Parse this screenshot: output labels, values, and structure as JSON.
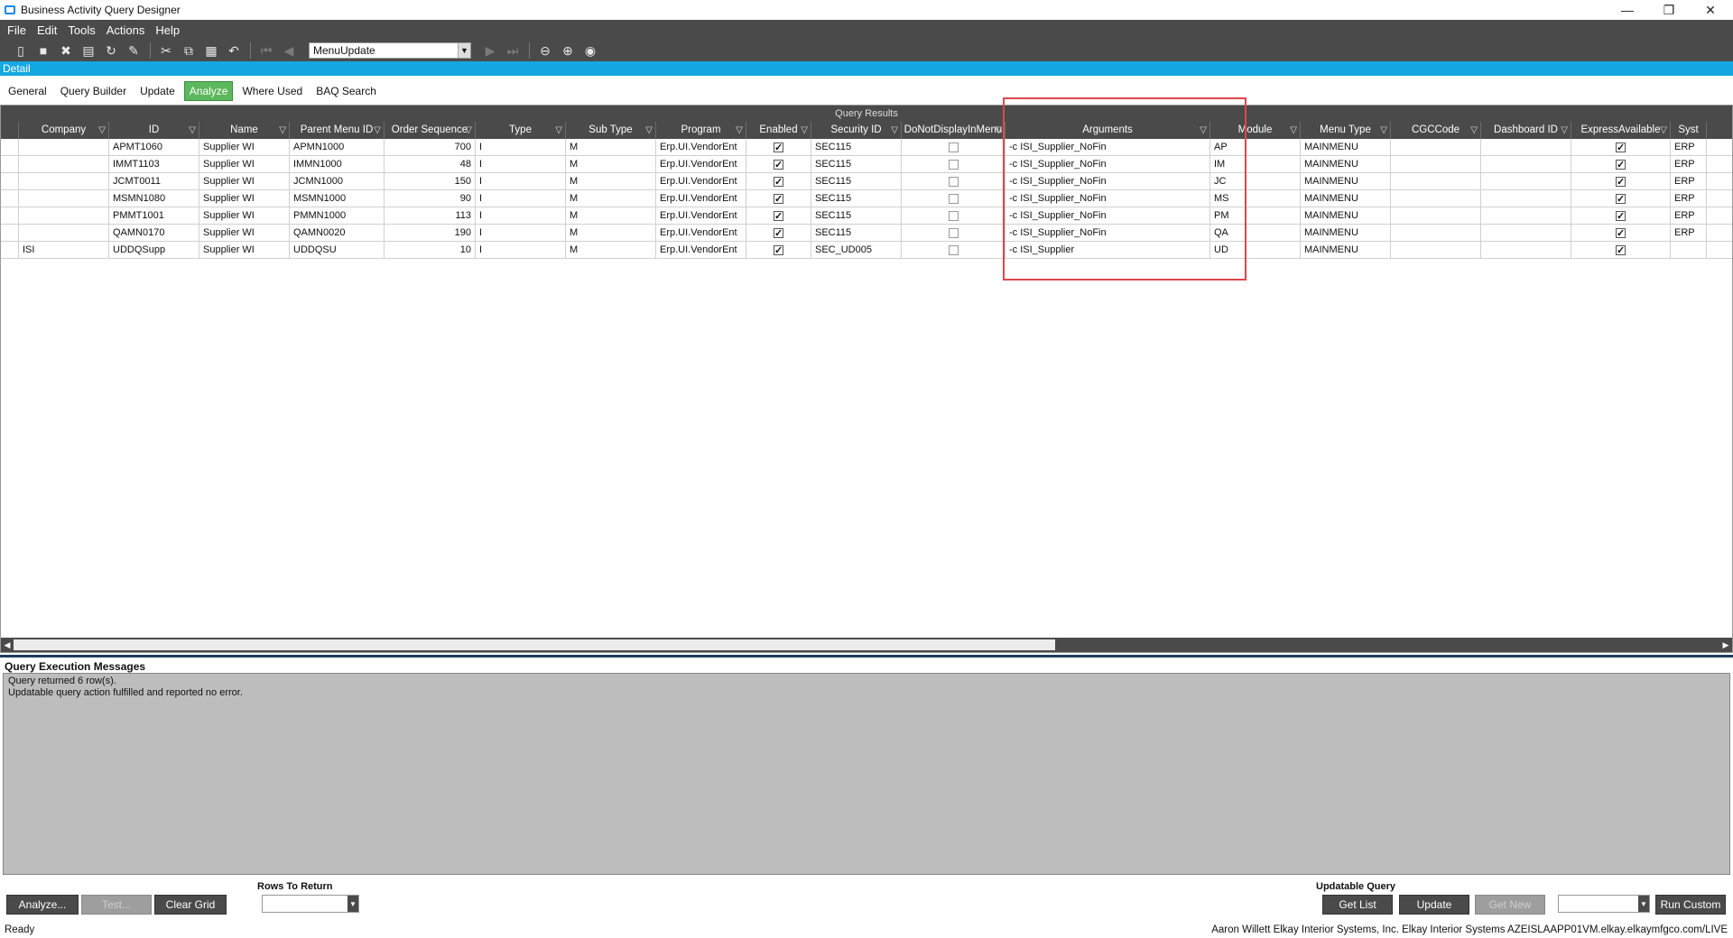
{
  "window": {
    "title": "Business Activity Query Designer",
    "minimize": "—",
    "restore": "❐",
    "close": "✕"
  },
  "menu": [
    "File",
    "Edit",
    "Tools",
    "Actions",
    "Help"
  ],
  "toolbar": {
    "combo_value": "MenuUpdate"
  },
  "detail_label": "Detail",
  "tabs": [
    "General",
    "Query Builder",
    "Update",
    "Analyze",
    "Where Used",
    "BAQ Search"
  ],
  "active_tab": "Analyze",
  "grid": {
    "caption": "Query Results",
    "columns": [
      "Company",
      "ID",
      "Name",
      "Parent Menu ID",
      "Order Sequence",
      "Type",
      "Sub Type",
      "Program",
      "Enabled",
      "Security ID",
      "DoNotDisplayInMenu",
      "Arguments",
      "Module",
      "Menu Type",
      "CGCCode",
      "Dashboard ID",
      "ExpressAvailable",
      "Syst"
    ],
    "rows": [
      {
        "company": "",
        "id": "APMT1060",
        "name": "Supplier WI",
        "parent": "APMN1000",
        "order": "700",
        "type": "I",
        "subtype": "M",
        "program": "Erp.UI.VendorEnt",
        "enabled": true,
        "security": "SEC115",
        "dndim": false,
        "args": "-c ISI_Supplier_NoFin",
        "module": "AP",
        "menutype": "MAINMENU",
        "cgc": "",
        "dash": "",
        "express": true,
        "syst": "ERP"
      },
      {
        "company": "",
        "id": "IMMT1103",
        "name": "Supplier WI",
        "parent": "IMMN1000",
        "order": "48",
        "type": "I",
        "subtype": "M",
        "program": "Erp.UI.VendorEnt",
        "enabled": true,
        "security": "SEC115",
        "dndim": false,
        "args": "-c ISI_Supplier_NoFin",
        "module": "IM",
        "menutype": "MAINMENU",
        "cgc": "",
        "dash": "",
        "express": true,
        "syst": "ERP"
      },
      {
        "company": "",
        "id": "JCMT0011",
        "name": "Supplier WI",
        "parent": "JCMN1000",
        "order": "150",
        "type": "I",
        "subtype": "M",
        "program": "Erp.UI.VendorEnt",
        "enabled": true,
        "security": "SEC115",
        "dndim": false,
        "args": "-c ISI_Supplier_NoFin",
        "module": "JC",
        "menutype": "MAINMENU",
        "cgc": "",
        "dash": "",
        "express": true,
        "syst": "ERP"
      },
      {
        "company": "",
        "id": "MSMN1080",
        "name": "Supplier WI",
        "parent": "MSMN1000",
        "order": "90",
        "type": "I",
        "subtype": "M",
        "program": "Erp.UI.VendorEnt",
        "enabled": true,
        "security": "SEC115",
        "dndim": false,
        "args": "-c ISI_Supplier_NoFin",
        "module": "MS",
        "menutype": "MAINMENU",
        "cgc": "",
        "dash": "",
        "express": true,
        "syst": "ERP"
      },
      {
        "company": "",
        "id": "PMMT1001",
        "name": "Supplier WI",
        "parent": "PMMN1000",
        "order": "113",
        "type": "I",
        "subtype": "M",
        "program": "Erp.UI.VendorEnt",
        "enabled": true,
        "security": "SEC115",
        "dndim": false,
        "args": "-c ISI_Supplier_NoFin",
        "module": "PM",
        "menutype": "MAINMENU",
        "cgc": "",
        "dash": "",
        "express": true,
        "syst": "ERP"
      },
      {
        "company": "",
        "id": "QAMN0170",
        "name": "Supplier WI",
        "parent": "QAMN0020",
        "order": "190",
        "type": "I",
        "subtype": "M",
        "program": "Erp.UI.VendorEnt",
        "enabled": true,
        "security": "SEC115",
        "dndim": false,
        "args": "-c ISI_Supplier_NoFin",
        "module": "QA",
        "menutype": "MAINMENU",
        "cgc": "",
        "dash": "",
        "express": true,
        "syst": "ERP"
      },
      {
        "company": "ISI",
        "id": "UDDQSupp",
        "name": "Supplier WI",
        "parent": "UDDQSU",
        "order": "10",
        "type": "I",
        "subtype": "M",
        "program": "Erp.UI.VendorEnt",
        "enabled": true,
        "security": "SEC_UD005",
        "dndim": false,
        "args": "-c ISI_Supplier",
        "module": "UD",
        "menutype": "MAINMENU",
        "cgc": "",
        "dash": "",
        "express": true,
        "syst": ""
      }
    ]
  },
  "messages": {
    "label": "Query Execution Messages",
    "lines": [
      "Query returned 6 row(s).",
      "Updatable query action fulfilled and reported no error."
    ]
  },
  "bottom": {
    "analyze": "Analyze...",
    "test": "Test...",
    "clear_grid": "Clear Grid",
    "rows_label": "Rows To Return",
    "updatable_label": "Updatable Query",
    "get_list": "Get List",
    "update": "Update",
    "get_new": "Get New",
    "run_custom": "Run Custom"
  },
  "status": {
    "left": "Ready",
    "right": "Aaron Willett  Elkay Interior Systems, Inc.  Elkay Interior Systems  AZEISLAAPP01VM.elkay.elkaymfgco.com/LIVE"
  },
  "colors": {
    "dark_bar": "#4a4a4a",
    "detail_bar": "#13a8e0",
    "active_tab": "#5cb85c",
    "highlight": "#e0474c"
  }
}
